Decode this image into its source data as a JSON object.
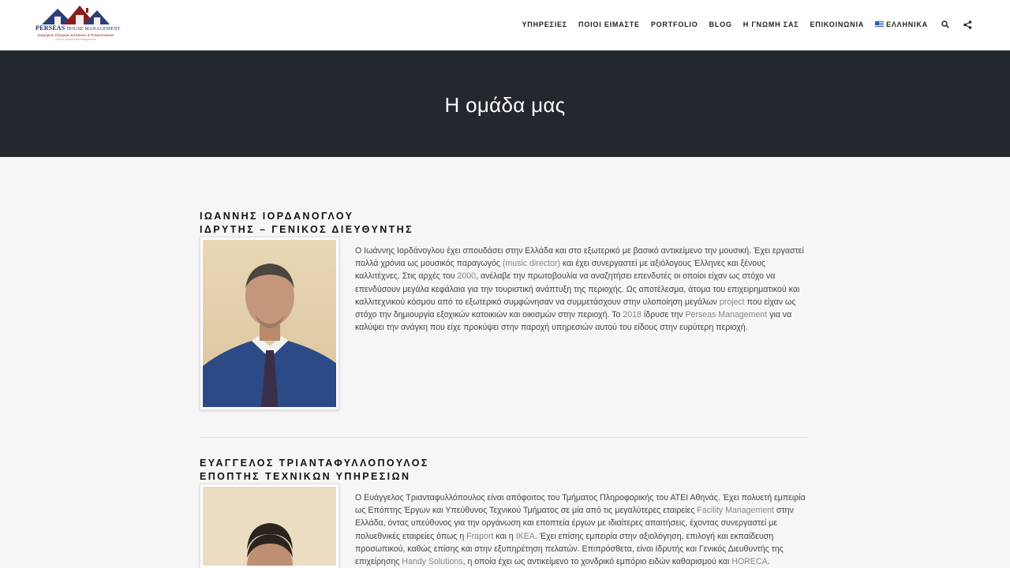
{
  "header": {
    "logo": {
      "brand": "PERSEAS",
      "brand_small": "HOUSE MANAGEMENT",
      "tagline": "Διαχείριση Εξοχικών Κατοικιών & Πολυκατοικιών",
      "tagline2": "Villas & Apartments Management"
    },
    "nav": [
      {
        "label": "ΥΠΗΡΕΣΙΕΣ"
      },
      {
        "label": "ΠΟΙΟΙ ΕΙΜΑΣΤΕ"
      },
      {
        "label": "PORTFOLIO"
      },
      {
        "label": "BLOG"
      },
      {
        "label": "Η ΓΝΩΜΗ ΣΑΣ"
      },
      {
        "label": "ΕΠΙΚΟΙΝΩΝΙΑ"
      },
      {
        "label": "ΕΛΛΗΝΙΚΑ"
      }
    ],
    "icons": [
      "search-icon",
      "share-icon"
    ]
  },
  "title_band": {
    "title": "Η ομάδα μας"
  },
  "members": [
    {
      "name": "ΙΩΑΝΝΗΣ ΙΟΡΔΑΝΟΓΛΟΥ",
      "role": "ΙΔΡΥΤΗΣ – ΓΕΝΙΚΟΣ ΔΙΕΥΘΥΝΤΗΣ",
      "bio": [
        {
          "t": "Ο Ιωάννης Ιορδάνογλου έχει σπουδάσει στην Ελλάδα και στο εξωτερικό με βασικό αντικείμενο την μουσική. Έχει εργαστεί πολλά χρόνια ως μουσικός παραγωγός "
        },
        {
          "t": "(music director)",
          "hl": true
        },
        {
          "t": " και έχει συνεργαστεί με αξιόλογους Έλληνες και ξένους καλλιτέχνες. Στις αρχές του "
        },
        {
          "t": "2000",
          "hl": true
        },
        {
          "t": ", ανέλαβε την πρωτοβουλία να αναζητήσει επενδυτές οι οποίοι είχαν ως στόχο να επενδύσουν μεγάλα κεφάλαια για την τουριστική ανάπτυξη της περιοχής. Ως αποτέλεσμα, άτομα του επιχειρηματικού και καλλιτεχνικού κόσμου από το εξωτερικό συμφώνησαν να συμμετάσχουν στην υλοποίηση μεγάλων "
        },
        {
          "t": "project",
          "hl": true
        },
        {
          "t": " που είχαν ως στόχο την δημιουργία εξοχικών κατοικιών και οικισμών στην περιοχή. Το "
        },
        {
          "t": "2018",
          "hl": true
        },
        {
          "t": " ίδρυσε την "
        },
        {
          "t": "Perseas Management",
          "hl": true
        },
        {
          "t": " για να καλύψει την ανάγκη που είχε προκύψει στην παροχή υπηρεσιών αυτού του είδους στην ευρύτερη περιοχή."
        }
      ]
    },
    {
      "name": "ΕΥΑΓΓΕΛΟΣ ΤΡΙΑΝΤΑΦΥΛΛΟΠΟΥΛΟΣ",
      "role": "ΕΠΟΠΤΗΣ ΤΕΧΝΙΚΩΝ ΥΠΗΡΕΣΙΩΝ",
      "bio": [
        {
          "t": "Ο Ευάγγελος Τριανταφυλλόπουλος είναι απόφοιτος του Τμήματος Πληροφορικής του ΑΤΕΙ Αθηνάς. Έχει πολυετή εμπειρία ως Επόπτης Έργων και Υπεύθυνος Τεχνικού Τμήματος σε μία από τις μεγαλύτερες εταιρείες "
        },
        {
          "t": "Facility Management",
          "hl": true
        },
        {
          "t": " στην Ελλάδα, όντας υπεύθυνος για την οργάνωση και εποπτεία έργων με ιδιαίτερες απαιτήσεις, έχοντας συνεργαστεί με πολυεθνικές εταιρείες όπως η "
        },
        {
          "t": "Fraport",
          "hl": true
        },
        {
          "t": " και η "
        },
        {
          "t": "IKEA",
          "hl": true
        },
        {
          "t": ". Έχει επίσης εμπειρία στην αξιολόγηση, επιλογή και εκπαίδευση προσωπικού, καθώς επίσης και στην εξυπηρέτηση πελατών. Επιπρόσθετα, είναι Ιδρυτής και Γενικός Διευθυντής της επιχείρησης "
        },
        {
          "t": "Handy Solutions",
          "hl": true
        },
        {
          "t": ", η οποία έχει ως αντικείμενο το χονδρικό εμπόριο ειδών καθαρισμού και "
        },
        {
          "t": "HORECA",
          "hl": true
        },
        {
          "t": "."
        }
      ]
    }
  ],
  "colors": {
    "band": "#23272e",
    "page_bg": "#f6f6f6",
    "text": "#444444",
    "highlight": "#888888"
  }
}
